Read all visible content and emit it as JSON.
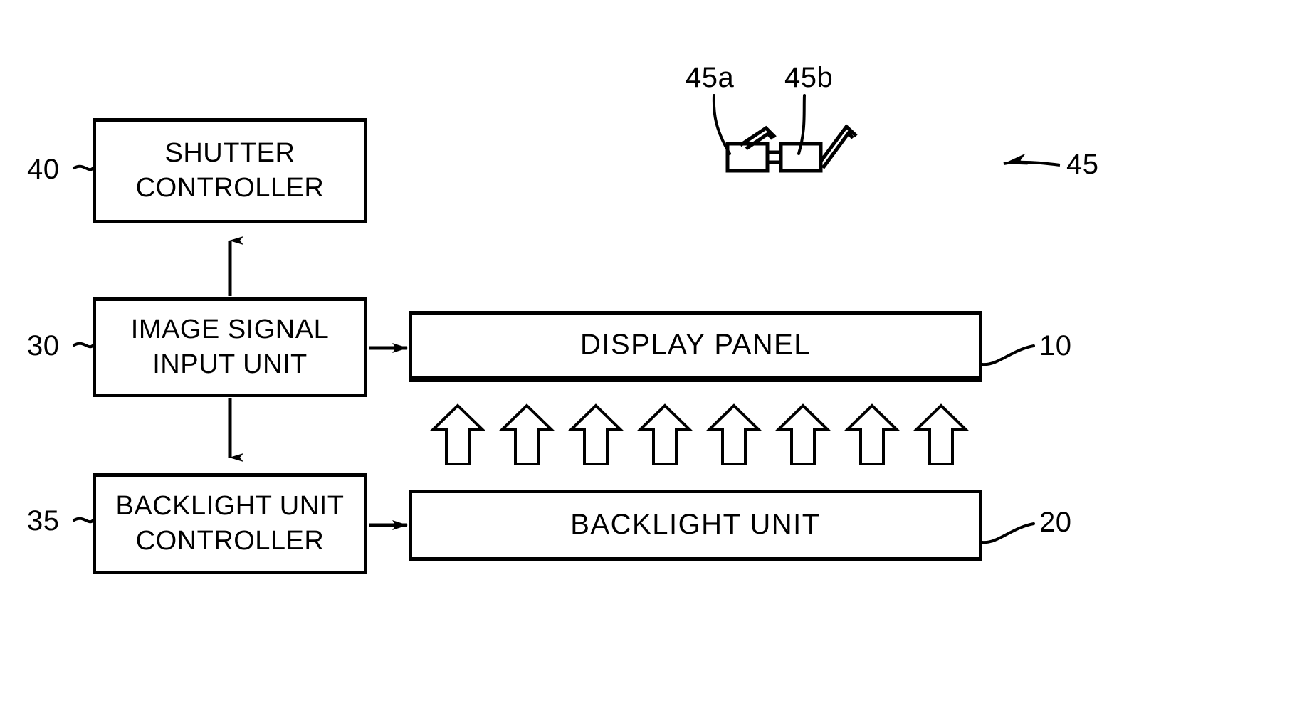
{
  "figure": {
    "type": "patent-block-diagram",
    "background_color": "#ffffff",
    "line_color": "#000000"
  },
  "blocks": [
    {
      "id": "40",
      "name": "shutter-controller",
      "label": "SHUTTER\nCONTROLLER"
    },
    {
      "id": "30",
      "name": "image-signal-input-unit",
      "label": "IMAGE SIGNAL\nINPUT UNIT"
    },
    {
      "id": "35",
      "name": "backlight-unit-controller",
      "label": "BACKLIGHT UNIT\nCONTROLLER"
    },
    {
      "id": "10",
      "name": "display-panel",
      "label": "DISPLAY PANEL"
    },
    {
      "id": "20",
      "name": "backlight-unit",
      "label": "BACKLIGHT UNIT"
    }
  ],
  "reference_numerals": {
    "shutter_controller": "40",
    "image_signal_input_unit": "30",
    "backlight_unit_controller": "35",
    "display_panel": "10",
    "backlight_unit": "20",
    "shutter_glasses": "45",
    "left_shutter": "45a",
    "right_shutter": "45b"
  },
  "connections": [
    {
      "name": "image-signal-to-shutter-controller",
      "from": "30",
      "to": "40",
      "direction": "up"
    },
    {
      "name": "image-signal-to-backlight-controller",
      "from": "30",
      "to": "35",
      "direction": "down"
    },
    {
      "name": "image-signal-to-display-panel",
      "from": "30",
      "to": "10",
      "direction": "right"
    },
    {
      "name": "backlight-controller-to-backlight-unit",
      "from": "35",
      "to": "20",
      "direction": "right"
    }
  ],
  "light_arrows": {
    "name": "backlight-emission-arrows",
    "count": 8,
    "direction": "up",
    "style": "hollow-outline",
    "description": "light emitted from backlight unit toward display panel"
  },
  "shutter_glasses": {
    "name": "shutter-glasses",
    "lens_left": "45a",
    "lens_right": "45b",
    "assembly": "45"
  }
}
